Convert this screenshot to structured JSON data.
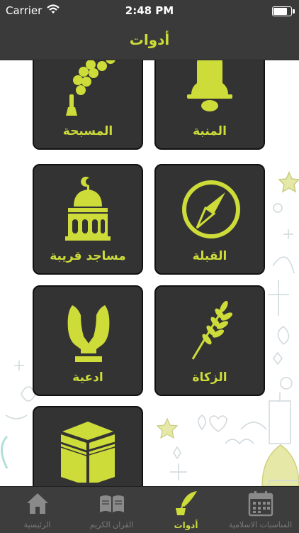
{
  "status": {
    "carrier": "Carrier",
    "time": "2:48 PM",
    "battery_level": 0.85
  },
  "header": {
    "title": "أدوات"
  },
  "tiles": [
    {
      "label": "المسبحة",
      "icon": "prayer-beads-icon"
    },
    {
      "label": "المنبة",
      "icon": "bell-icon"
    },
    {
      "label": "مساجد قريبة",
      "icon": "mosque-icon"
    },
    {
      "label": "القبلة",
      "icon": "compass-icon"
    },
    {
      "label": "ادعية",
      "icon": "praying-hands-icon"
    },
    {
      "label": "الزكاة",
      "icon": "wheat-icon"
    },
    {
      "label": "",
      "icon": "kaaba-icon"
    }
  ],
  "tabs": [
    {
      "label": "الرئيسية",
      "icon": "home-icon",
      "active": false
    },
    {
      "label": "القران الكريم",
      "icon": "quran-book-icon",
      "active": false
    },
    {
      "label": "أدوات",
      "icon": "feather-ink-icon",
      "active": true
    },
    {
      "label": "المناسبات الاسلامية",
      "icon": "calendar-icon",
      "active": false
    }
  ],
  "colors": {
    "accent": "#cddc39",
    "bar_background": "#3a3a3a",
    "tile_background": "#333333",
    "inactive_tab": "#7a7a7a"
  }
}
